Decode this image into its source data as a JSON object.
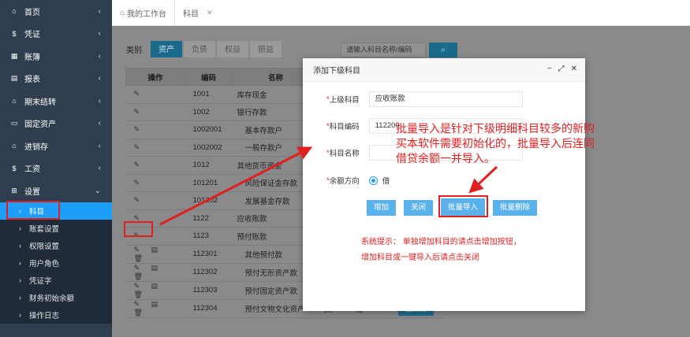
{
  "sidebar": {
    "nav": [
      {
        "icon": "home-icon",
        "glyph": "⌂",
        "label": "首页"
      },
      {
        "icon": "dollar-icon",
        "glyph": "$",
        "label": "凭证"
      },
      {
        "icon": "book-icon",
        "glyph": "▦",
        "label": "账簿"
      },
      {
        "icon": "report-icon",
        "glyph": "▤",
        "label": "报表"
      },
      {
        "icon": "period-icon",
        "glyph": "⌂",
        "label": "期末结转"
      },
      {
        "icon": "monitor-icon",
        "glyph": "▭",
        "label": "固定资产"
      },
      {
        "icon": "inventory-icon",
        "glyph": "⌂",
        "label": "进销存"
      },
      {
        "icon": "dollar-icon",
        "glyph": "$",
        "label": "工资"
      },
      {
        "icon": "settings-grid-icon",
        "glyph": "⊞",
        "label": "设置"
      }
    ],
    "sub": [
      "科目",
      "账套设置",
      "权限设置",
      "用户角色",
      "凭证字",
      "财务初始余额",
      "操作日志"
    ]
  },
  "tabs": {
    "home": "我的工作台",
    "current": "科目"
  },
  "filter": {
    "label": "类别",
    "segments": [
      "资产",
      "负债",
      "权益",
      "损益"
    ]
  },
  "search": {
    "placeholder": "请输入科目名称/编码"
  },
  "table": {
    "headers": {
      "op": "操作",
      "code": "编码",
      "name": "名称"
    },
    "rows": [
      {
        "code": "1001",
        "name": "库存现金"
      },
      {
        "code": "1002",
        "name": "银行存款"
      },
      {
        "code": "1002001",
        "name": "基本存款户"
      },
      {
        "code": "1002002",
        "name": "一般存款户"
      },
      {
        "code": "1012",
        "name": "其他货币资金"
      },
      {
        "code": "101201",
        "name": "风险保证金存款"
      },
      {
        "code": "101202",
        "name": "发展基金存款"
      },
      {
        "code": "1122",
        "name": "应收账款"
      },
      {
        "code": "1123",
        "name": "预付账款"
      },
      {
        "code": "112301",
        "name": "其他预付款"
      },
      {
        "code": "112302",
        "name": "预付无形资产款"
      },
      {
        "code": "112303",
        "name": "预付固定资产款"
      },
      {
        "code": "112304",
        "name": "预付文物文化资产",
        "type": "资产",
        "direction": "借",
        "status": "已启用"
      }
    ]
  },
  "modal": {
    "title": "添加下级科目",
    "fields": {
      "parent_label": "上级科目",
      "parent_value": "应收账款",
      "code_label": "科目编码",
      "code_value": "112200",
      "name_label": "科目名称",
      "name_value": "",
      "dir_label": "余额方向",
      "dir_value": "借"
    },
    "buttons": {
      "add": "增加",
      "close": "关闭",
      "import": "批量导入",
      "delete": "批量删除"
    },
    "tip_line1": "系统提示： 单独增加科目的请点击增加按钮，",
    "tip_line2": "增加科目或一键导入后请点击关闭"
  },
  "annotation": "批量导入是针对下级明细科目较多的新购买本软件需要初始化的，批量导入后连同借贷余额一并导入。"
}
